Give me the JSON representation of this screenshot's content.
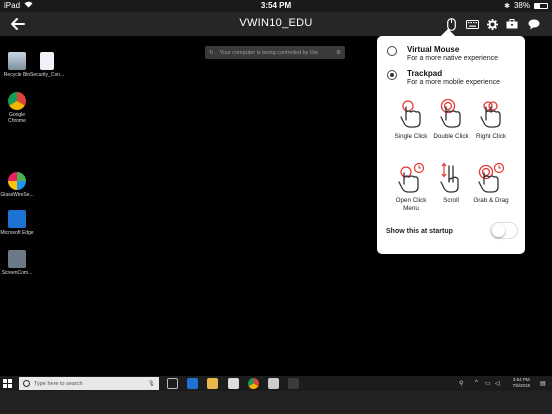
{
  "status_bar": {
    "device": "iPad",
    "time": "3:54 PM",
    "battery": "38%"
  },
  "toolbar": {
    "title": "VWIN10_EDU"
  },
  "desktop": {
    "notice": "Your computer is being controlled by Ow",
    "icons": [
      {
        "label": "Recycle Bin"
      },
      {
        "label": "Security_Con..."
      },
      {
        "label": "Google Chrome"
      },
      {
        "label": "GlassWireSe..."
      },
      {
        "label": "Microsoft Edge"
      },
      {
        "label": "ScreenCom..."
      }
    ]
  },
  "taskbar": {
    "search_placeholder": "Type here to search",
    "clock_time": "3:54 PM",
    "clock_date": "7/5/2018"
  },
  "popover": {
    "options": [
      {
        "title": "Virtual Mouse",
        "subtitle": "For a more native experience",
        "selected": false
      },
      {
        "title": "Trackpad",
        "subtitle": "For a more mobile experience",
        "selected": true
      }
    ],
    "gestures": [
      {
        "label": "Single Click",
        "icon": "single-click-icon"
      },
      {
        "label": "Double Click",
        "icon": "double-click-icon"
      },
      {
        "label": "Right Click",
        "icon": "right-click-icon"
      },
      {
        "label": "Open Click Menu",
        "icon": "open-click-menu-icon"
      },
      {
        "label": "Scroll",
        "icon": "scroll-icon"
      },
      {
        "label": "Grab & Drag",
        "icon": "grab-drag-icon"
      }
    ],
    "startup_label": "Show this at startup",
    "startup_enabled": false
  },
  "colors": {
    "accent_red": "#e53935",
    "popover_bg": "#ffffff"
  }
}
